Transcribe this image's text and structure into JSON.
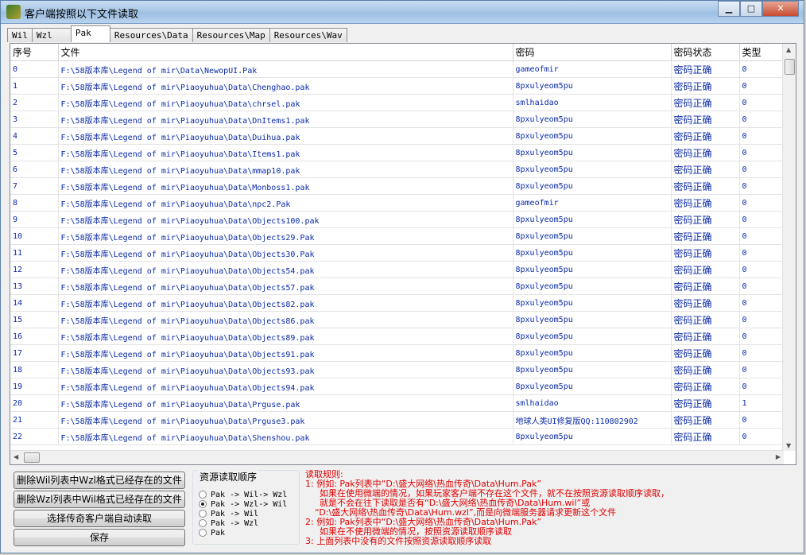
{
  "window": {
    "title": "客户端按照以下文件读取"
  },
  "tabs": [
    "Wil",
    "Wzl",
    "Pak",
    "Resources\\Data",
    "Resources\\Map",
    "Resources\\Wav"
  ],
  "table": {
    "headers": [
      "序号",
      "文件",
      "密码",
      "密码状态",
      "类型"
    ],
    "rows": [
      [
        "0",
        "F:\\58版本库\\Legend of mir\\Data\\NewopUI.Pak",
        "gameofmir",
        "密码正确",
        "0"
      ],
      [
        "1",
        "F:\\58版本库\\Legend of mir\\Piaoyuhua\\Data\\Chenghao.pak",
        "8pxulyeom5pu",
        "密码正确",
        "0"
      ],
      [
        "2",
        "F:\\58版本库\\Legend of mir\\Piaoyuhua\\Data\\chrsel.pak",
        "smlhaidao",
        "密码正确",
        "0"
      ],
      [
        "3",
        "F:\\58版本库\\Legend of mir\\Piaoyuhua\\Data\\DnItems1.pak",
        "8pxulyeom5pu",
        "密码正确",
        "0"
      ],
      [
        "4",
        "F:\\58版本库\\Legend of mir\\Piaoyuhua\\Data\\Duihua.pak",
        "8pxulyeom5pu",
        "密码正确",
        "0"
      ],
      [
        "5",
        "F:\\58版本库\\Legend of mir\\Piaoyuhua\\Data\\Items1.pak",
        "8pxulyeom5pu",
        "密码正确",
        "0"
      ],
      [
        "6",
        "F:\\58版本库\\Legend of mir\\Piaoyuhua\\Data\\mmap10.pak",
        "8pxulyeom5pu",
        "密码正确",
        "0"
      ],
      [
        "7",
        "F:\\58版本库\\Legend of mir\\Piaoyuhua\\Data\\Monboss1.pak",
        "8pxulyeom5pu",
        "密码正确",
        "0"
      ],
      [
        "8",
        "F:\\58版本库\\Legend of mir\\Piaoyuhua\\Data\\npc2.Pak",
        "gameofmir",
        "密码正确",
        "0"
      ],
      [
        "9",
        "F:\\58版本库\\Legend of mir\\Piaoyuhua\\Data\\Objects100.pak",
        "8pxulyeom5pu",
        "密码正确",
        "0"
      ],
      [
        "10",
        "F:\\58版本库\\Legend of mir\\Piaoyuhua\\Data\\Objects29.Pak",
        "8pxulyeom5pu",
        "密码正确",
        "0"
      ],
      [
        "11",
        "F:\\58版本库\\Legend of mir\\Piaoyuhua\\Data\\Objects30.Pak",
        "8pxulyeom5pu",
        "密码正确",
        "0"
      ],
      [
        "12",
        "F:\\58版本库\\Legend of mir\\Piaoyuhua\\Data\\Objects54.pak",
        "8pxulyeom5pu",
        "密码正确",
        "0"
      ],
      [
        "13",
        "F:\\58版本库\\Legend of mir\\Piaoyuhua\\Data\\Objects57.pak",
        "8pxulyeom5pu",
        "密码正确",
        "0"
      ],
      [
        "14",
        "F:\\58版本库\\Legend of mir\\Piaoyuhua\\Data\\Objects82.pak",
        "8pxulyeom5pu",
        "密码正确",
        "0"
      ],
      [
        "15",
        "F:\\58版本库\\Legend of mir\\Piaoyuhua\\Data\\Objects86.pak",
        "8pxulyeom5pu",
        "密码正确",
        "0"
      ],
      [
        "16",
        "F:\\58版本库\\Legend of mir\\Piaoyuhua\\Data\\Objects89.pak",
        "8pxulyeom5pu",
        "密码正确",
        "0"
      ],
      [
        "17",
        "F:\\58版本库\\Legend of mir\\Piaoyuhua\\Data\\Objects91.pak",
        "8pxulyeom5pu",
        "密码正确",
        "0"
      ],
      [
        "18",
        "F:\\58版本库\\Legend of mir\\Piaoyuhua\\Data\\Objects93.pak",
        "8pxulyeom5pu",
        "密码正确",
        "0"
      ],
      [
        "19",
        "F:\\58版本库\\Legend of mir\\Piaoyuhua\\Data\\Objects94.pak",
        "8pxulyeom5pu",
        "密码正确",
        "0"
      ],
      [
        "20",
        "F:\\58版本库\\Legend of mir\\Piaoyuhua\\Data\\Prguse.pak",
        "smlhaidao",
        "密码正确",
        "1"
      ],
      [
        "21",
        "F:\\58版本库\\Legend of mir\\Piaoyuhua\\Data\\Prguse3.pak",
        "地球人类UI修复版QQ:110802902",
        "密码正确",
        "0"
      ],
      [
        "22",
        "F:\\58版本库\\Legend of mir\\Piaoyuhua\\Data\\Shenshou.pak",
        "8pxulyeom5pu",
        "密码正确",
        "0"
      ]
    ]
  },
  "buttons": {
    "delete_wil": "删除Wil列表中Wzl格式已经存在的文件",
    "delete_wzl": "删除Wzl列表中Wil格式已经存在的文件",
    "auto_read": "选择传奇客户端自动读取",
    "save": "保存"
  },
  "read_order": {
    "title": "资源读取顺序",
    "options": [
      "Pak -> Wil-> Wzl",
      "Pak -> Wzl-> Wil",
      "Pak -> Wil",
      "Pak -> Wzl",
      "Pak"
    ],
    "selected_index": 1
  },
  "rules": {
    "heading": "读取规则:",
    "lines": [
      "1: 例如: Pak列表中“D:\\盛大网络\\热血传奇\\Data\\Hum.Pak”",
      "如果在使用微端的情况，如果玩家客户端不存在这个文件，就不在按照资源读取顺序读取，",
      "就是不会在往下读取是否有“D:\\盛大网络\\热血传奇\\Data\\Hum.wil”或",
      "“D:\\盛大网络\\热血传奇\\Data\\Hum.wzl”,而是向微端服务器请求更新这个文件",
      "2: 例如: Pak列表中“D:\\盛大网络\\热血传奇\\Data\\Hum.Pak”",
      "如果在不使用微端的情况，按照资源读取顺序读取",
      "3: 上面列表中没有的文件按照资源读取顺序读取"
    ]
  },
  "colors": {
    "link_text": "#0a2aa8",
    "rules_text": "#e00000"
  }
}
